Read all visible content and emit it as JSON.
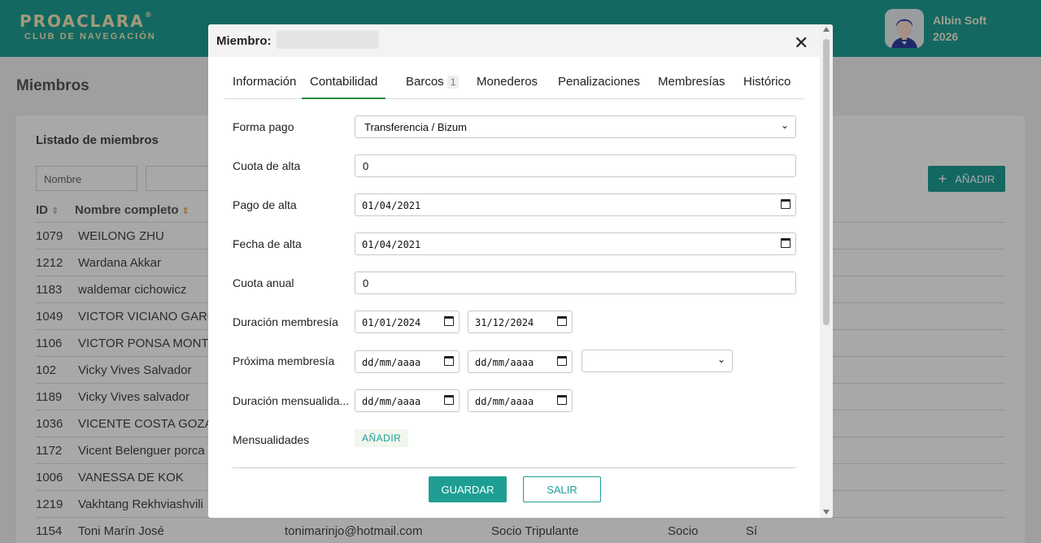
{
  "brand": {
    "name": "PROACLARA",
    "reg": "®",
    "subtitle": "CLUB DE NAVEGACIÓN"
  },
  "user": {
    "name": "Albin Soft",
    "year": "2026"
  },
  "page": {
    "title": "Miembros"
  },
  "list": {
    "title": "Listado de miembros",
    "filter_name_placeholder": "Nombre",
    "add_label": "AÑADIR",
    "columns": {
      "id": "ID",
      "name": "Nombre completo"
    },
    "rows": [
      {
        "id": "1079",
        "name": "WEILONG ZHU"
      },
      {
        "id": "1212",
        "name": "Wardana Akkar"
      },
      {
        "id": "1183",
        "name": "waldemar cichowicz"
      },
      {
        "id": "1049",
        "name": "VICTOR VICIANO GARC"
      },
      {
        "id": "1106",
        "name": "VICTOR PONSA MONTE"
      },
      {
        "id": "102",
        "name": "Vicky Vives Salvador"
      },
      {
        "id": "1189",
        "name": "Vicky Vives salvador"
      },
      {
        "id": "1036",
        "name": "VICENTE COSTA GOZAL"
      },
      {
        "id": "1172",
        "name": "Vicent Belenguer porca"
      },
      {
        "id": "1006",
        "name": "VANESSA DE KOK"
      },
      {
        "id": "1219",
        "name": "Vakhtang Rekhviashvili"
      },
      {
        "id": "1154",
        "name": "Toni Marín José",
        "email": "tonimarinjo@hotmail.com",
        "type": "Socio Tripulante",
        "role": "Socio",
        "active": "Sí"
      }
    ]
  },
  "modal": {
    "title": "Miembro:",
    "tabs": [
      {
        "label": "Información"
      },
      {
        "label": "Contabilidad"
      },
      {
        "label": "Barcos",
        "badge": "1"
      },
      {
        "label": "Monederos"
      },
      {
        "label": "Penalizaciones"
      },
      {
        "label": "Membresías"
      },
      {
        "label": "Histórico"
      }
    ],
    "form": {
      "forma_pago": {
        "label": "Forma pago",
        "value": "Transferencia / Bizum"
      },
      "cuota_alta": {
        "label": "Cuota de alta",
        "value": "0"
      },
      "pago_alta": {
        "label": "Pago de alta",
        "value": "01/04/2021"
      },
      "fecha_alta": {
        "label": "Fecha de alta",
        "value": "01/04/2021"
      },
      "cuota_anual": {
        "label": "Cuota anual",
        "value": "0"
      },
      "duracion_membresia": {
        "label": "Duración membresía",
        "from": "01/01/2024",
        "to": "31/12/2024"
      },
      "proxima_membresia": {
        "label": "Próxima membresía",
        "from": "dd/mm/aaaa",
        "to": "dd/mm/aaaa",
        "select": ""
      },
      "duracion_mensualidad": {
        "label": "Duración mensualida...",
        "from": "dd/mm/aaaa",
        "to": "dd/mm/aaaa"
      },
      "mensualidades": {
        "label": "Mensualidades",
        "add_label": "AÑADIR"
      }
    },
    "save_label": "GUARDAR",
    "exit_label": "SALIR"
  },
  "colors": {
    "brand": "#1e9e93",
    "brand_text": "#f3e9b8",
    "active_tab": "#2a8a3a"
  },
  "icons": {
    "close": "close-icon",
    "calendar": "calendar-icon",
    "sort": "sort-icon",
    "plus": "plus-icon",
    "chevron": "chevron-down-icon"
  }
}
